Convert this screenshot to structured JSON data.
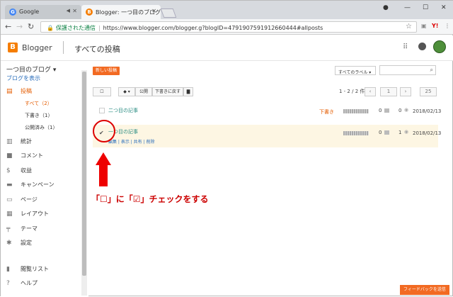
{
  "browser": {
    "tabs": [
      {
        "title": "Google",
        "favicon": "G"
      },
      {
        "title": "Blogger: 一つ目のブログ ·",
        "favicon": "B"
      }
    ],
    "address": {
      "secure_label": "保護された通信",
      "url": "https://www.blogger.com/blogger.g?blogID=4791907591912660444#allposts"
    }
  },
  "header": {
    "brand": "Blogger",
    "page_title": "すべての投稿"
  },
  "sidebar": {
    "blog_name": "一つ目のブログ ▾",
    "view_blog": "ブログを表示",
    "posts_label": "投稿",
    "sub": [
      {
        "label": "すべて（2）"
      },
      {
        "label": "下書き（1）"
      },
      {
        "label": "公開済み（1）"
      }
    ],
    "items": [
      {
        "label": "統計",
        "icon": "bar-chart-icon"
      },
      {
        "label": "コメント",
        "icon": "comment-icon"
      },
      {
        "label": "収益",
        "icon": "dollar-icon"
      },
      {
        "label": "キャンペーン",
        "icon": "campaign-icon"
      },
      {
        "label": "ページ",
        "icon": "page-icon"
      },
      {
        "label": "レイアウト",
        "icon": "layout-icon"
      },
      {
        "label": "テーマ",
        "icon": "paint-roller-icon"
      },
      {
        "label": "設定",
        "icon": "gear-icon"
      },
      {
        "label": "閲覧リスト",
        "icon": "bookmark-icon"
      },
      {
        "label": "ヘルプ",
        "icon": "help-icon"
      }
    ]
  },
  "main": {
    "new_post": "新しい投稿",
    "labels_select": "すべてのラベル ▾",
    "toolbar": {
      "publish": "公開",
      "revert": "下書きに戻す",
      "range": "1 - 2 / 2 件",
      "page": "1",
      "per_page": "25"
    },
    "posts": [
      {
        "title": "二つ目の記事",
        "status": "下書き",
        "comments": "0",
        "views": "0",
        "date": "2018/02/13",
        "links": ""
      },
      {
        "title": "一つ目の記事",
        "status": "",
        "comments": "0",
        "views": "1",
        "date": "2018/02/13",
        "links": "編集 | 表示 | 共有 | 削除"
      }
    ]
  },
  "annotation": {
    "text": "「☐」に「☑」チェックをする",
    "color": "#cc0000"
  },
  "feedback_button": "フィードバックを送信",
  "accent": "#f26a22"
}
